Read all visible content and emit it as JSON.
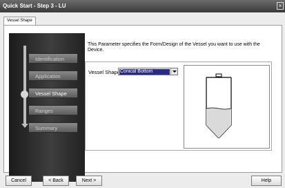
{
  "window": {
    "title": "Quick Start - Step 3 - LU",
    "close_glyph": "×"
  },
  "tabs": [
    {
      "label": "Vessel Shape"
    }
  ],
  "nav": {
    "steps": [
      {
        "label": "Identification"
      },
      {
        "label": "Application"
      },
      {
        "label": "Vessel Shape"
      },
      {
        "label": "Ranges"
      },
      {
        "label": "Summary"
      }
    ],
    "active_step": "Vessel Shape"
  },
  "content": {
    "description": "This Parameter specifies the Form/Design of the Vessel you want to use with the Device.",
    "vessel_shape_label": "Vessel Shape",
    "vessel_shape_value": "Conical Bottom",
    "preview_icon": "conical-bottom-vessel-diagram"
  },
  "buttons": {
    "cancel": "Cancel",
    "back": "< Back",
    "next": "Next >",
    "help": "Help"
  },
  "colors": {
    "titlebar": "#4a4a4a",
    "nav_dark": "#262626",
    "selection": "#2a2a8a"
  }
}
